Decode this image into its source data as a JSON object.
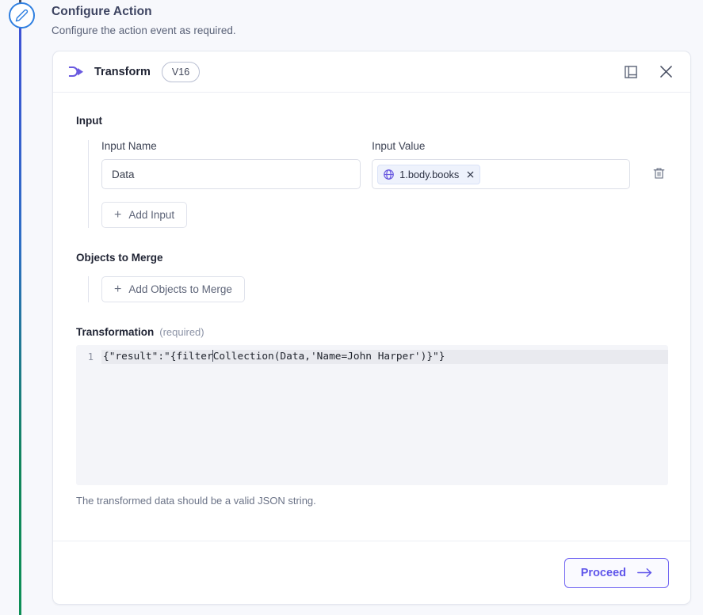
{
  "header": {
    "title": "Configure Action",
    "subtitle": "Configure the action event as required."
  },
  "rail": {
    "node_icon": "pencil-icon",
    "line_color_top": "#3f51d6",
    "line_color_bottom": "#0e8f56"
  },
  "card": {
    "icon": "transform-icon",
    "title": "Transform",
    "version_badge": "V16",
    "docs_icon": "book-icon",
    "close_icon": "close-icon"
  },
  "input_section": {
    "title": "Input",
    "name_label": "Input Name",
    "value_label": "Input Value",
    "name_value": "Data",
    "name_placeholder": "Input Name",
    "chip": {
      "icon": "globe-icon",
      "text": "1.body.books",
      "remove_icon": "close-small-icon"
    },
    "delete_icon": "trash-icon",
    "add_button": "Add Input",
    "add_icon": "plus-icon"
  },
  "merge_section": {
    "title": "Objects to Merge",
    "add_button": "Add Objects to Merge",
    "add_icon": "plus-icon"
  },
  "transformation_section": {
    "title": "Transformation",
    "required_label": "(required)",
    "line_number": "1",
    "code_before_caret": "{\"result\":\"{filter",
    "code_after_caret": "Collection(Data,'Name=John Harper')}\"}",
    "helper_text": "The transformed data should be a valid JSON string."
  },
  "footer": {
    "proceed_label": "Proceed",
    "proceed_icon": "arrow-right-icon"
  },
  "colors": {
    "accent_purple": "#5f55ea",
    "chip_purple": "#6a5ae0",
    "rail_blue": "#3f51d6",
    "rail_green": "#0e8f56"
  }
}
